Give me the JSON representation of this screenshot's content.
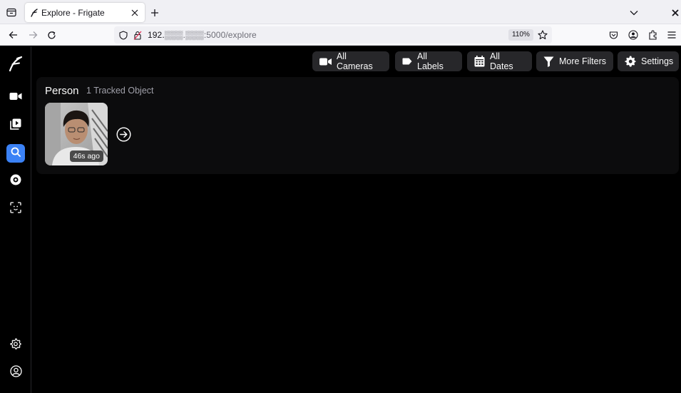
{
  "browser": {
    "tab": {
      "title": "Explore - Frigate"
    },
    "url": {
      "host": "192.",
      "blurred": "▒▒▒.▒▒▒",
      "rest": ":5000/explore"
    },
    "zoom": "110%"
  },
  "toolbar": {
    "buttons": [
      {
        "label": "All Cameras",
        "icon": "camera-icon"
      },
      {
        "label": "All Labels",
        "icon": "tag-icon"
      },
      {
        "label": "All Dates",
        "icon": "calendar-icon"
      },
      {
        "label": "More Filters",
        "icon": "filter-icon"
      },
      {
        "label": "Settings",
        "icon": "gear-icon"
      }
    ]
  },
  "sidebar": {
    "items": [
      {
        "name": "live",
        "icon": "video-camera-icon"
      },
      {
        "name": "review",
        "icon": "play-library-icon"
      },
      {
        "name": "explore",
        "icon": "search-icon",
        "active": true
      },
      {
        "name": "export",
        "icon": "disc-icon"
      },
      {
        "name": "faces",
        "icon": "face-scan-icon"
      },
      {
        "name": "settings",
        "icon": "gear-icon"
      },
      {
        "name": "account",
        "icon": "user-icon"
      }
    ]
  },
  "explore": {
    "group": {
      "label": "Person",
      "count": "1 Tracked Object",
      "items": [
        {
          "time": "46s ago"
        }
      ]
    }
  },
  "colors": {
    "accent": "#3b82f6",
    "background": "#000000",
    "panel": "#0c0c0d",
    "button": "#27272a"
  }
}
